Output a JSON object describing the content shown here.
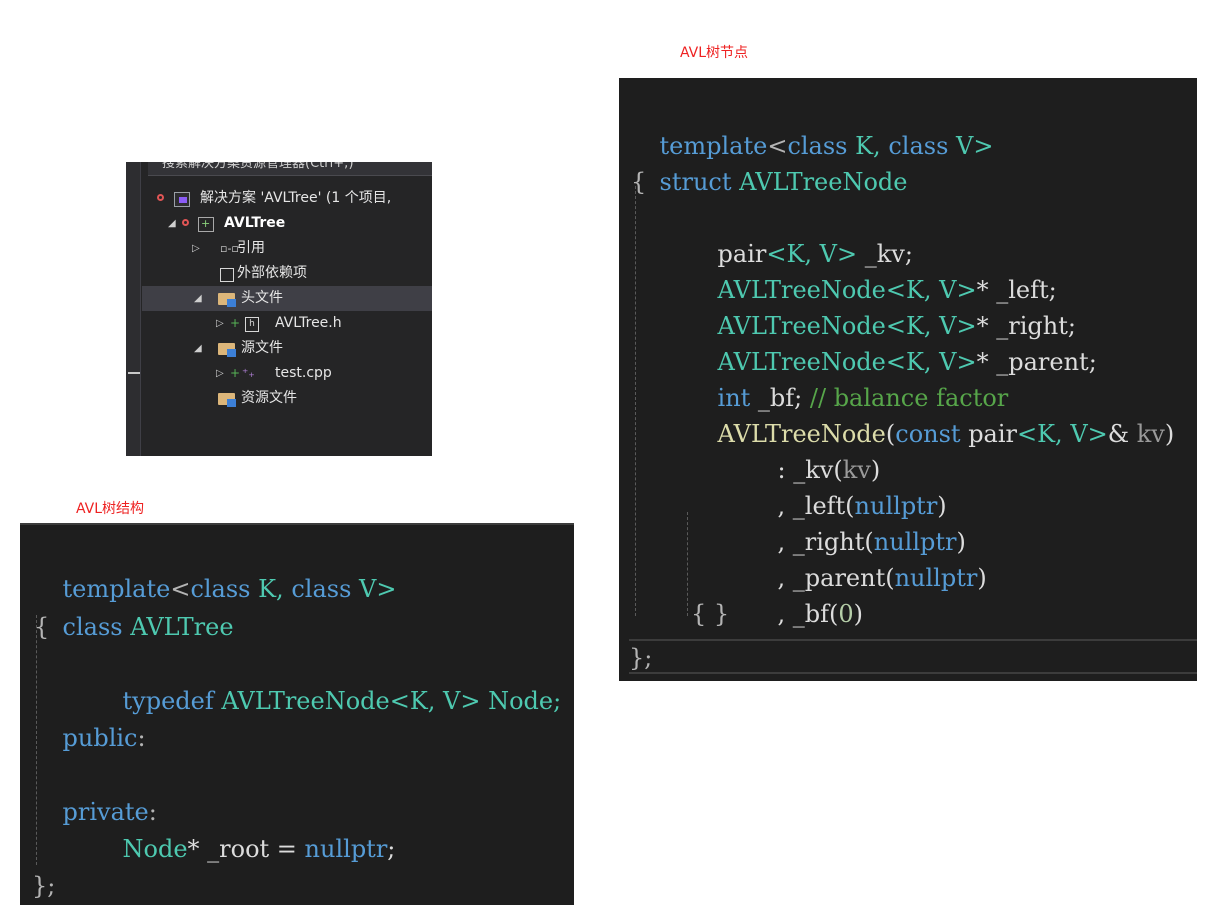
{
  "captions": {
    "node": "AVL树节点",
    "tree": "AVL树结构"
  },
  "explorer": {
    "search_placeholder": "搜索解决方案资源管理器(Ctrl+;)",
    "solution_label": "解决方案 'AVLTree' (1 个项目,",
    "project_label": "AVLTree",
    "references_label": "引用",
    "external_deps_label": "外部依赖项",
    "header_folder_label": "头文件",
    "header_file_label": "AVLTree.h",
    "source_folder_label": "源文件",
    "source_file_label": "test.cpp",
    "resource_folder_label": "资源文件"
  },
  "node_code": {
    "l1": {
      "a": "template",
      "b": "<",
      "c": "class",
      "d": " K, ",
      "e": "class",
      "f": " V>"
    },
    "l2": {
      "a": "struct",
      "b": " AVLTreeNode"
    },
    "l3": "{",
    "l4": {
      "a": "pair",
      "b": "<K, V>",
      "c": " _kv;"
    },
    "l5": {
      "a": "AVLTreeNode",
      "b": "<K, V>",
      "c": "* _left;"
    },
    "l6": {
      "a": "AVLTreeNode",
      "b": "<K, V>",
      "c": "* _right;"
    },
    "l7": {
      "a": "AVLTreeNode",
      "b": "<K, V>",
      "c": "* _parent;"
    },
    "l8": {
      "a": "int",
      "b": " _bf; ",
      "c": "// balance factor"
    },
    "l9": {
      "a": "AVLTreeNode",
      "b": "(",
      "c": "const",
      "d": " pair",
      "e": "<K, V>",
      "f": "& ",
      "g": "kv",
      ")": ")"
    },
    "l10": {
      "a": ": _kv(",
      "b": "kv",
      "c": ")"
    },
    "l11": {
      "a": ", _left(",
      "b": "nullptr",
      "c": ")"
    },
    "l12": {
      "a": ", _right(",
      "b": "nullptr",
      "c": ")"
    },
    "l13": {
      "a": ", _parent(",
      "b": "nullptr",
      "c": ")"
    },
    "l14": {
      "a": ", _bf(",
      "b": "0",
      "c": ")"
    },
    "l15": "{ }",
    "l16": "};"
  },
  "tree_code": {
    "l1": {
      "a": "template",
      "b": "<",
      "c": "class",
      "d": " K, ",
      "e": "class",
      "f": " V>"
    },
    "l2": {
      "a": "class",
      "b": " AVLTree"
    },
    "l3": "{",
    "l4": {
      "a": "typedef",
      "b": " AVLTreeNode",
      "c": "<K, V>",
      "d": " Node;"
    },
    "l5": {
      "a": "public",
      "b": ":"
    },
    "l6": {
      "a": "private",
      "b": ":"
    },
    "l7": {
      "a": "Node",
      "b": "* _root = ",
      "c": "nullptr",
      "d": ";"
    },
    "l8": "};"
  },
  "colors": {
    "keyword": "#569cd6",
    "type": "#4ec9b0",
    "function": "#dcdcaa",
    "comment": "#57a64a",
    "caption": "#ee2222"
  }
}
